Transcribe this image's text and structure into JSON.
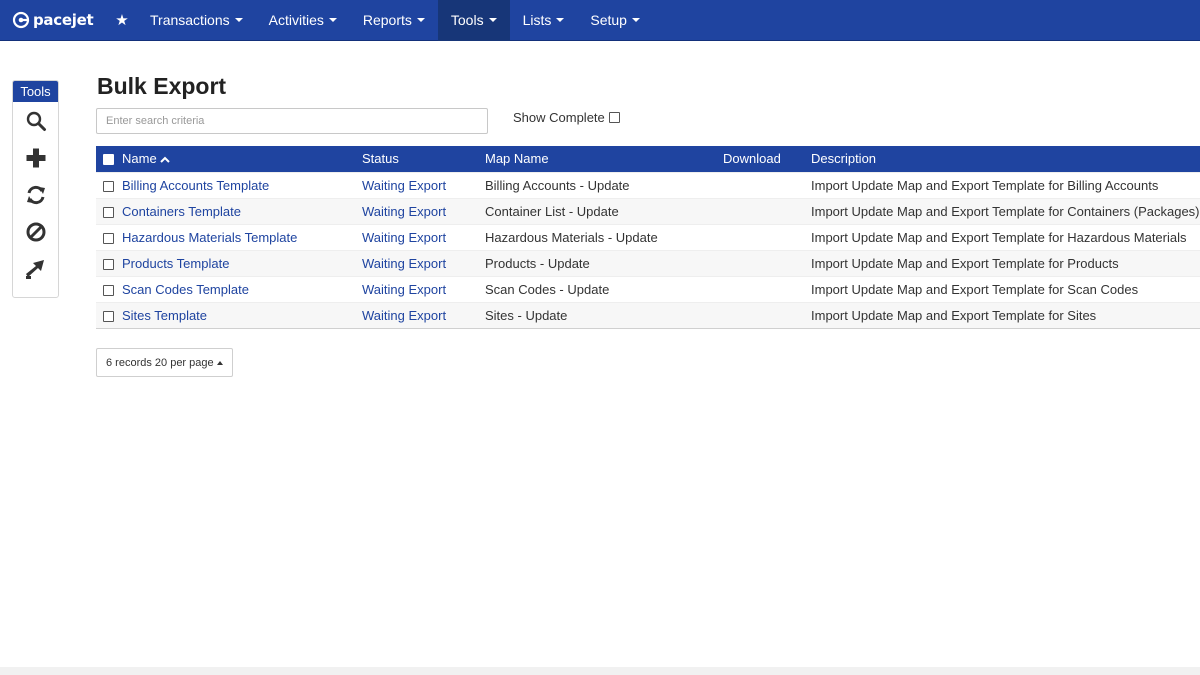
{
  "brand": {
    "name": "pacejet"
  },
  "nav": {
    "items": [
      {
        "label": "Transactions",
        "active": false
      },
      {
        "label": "Activities",
        "active": false
      },
      {
        "label": "Reports",
        "active": false
      },
      {
        "label": "Tools",
        "active": true
      },
      {
        "label": "Lists",
        "active": false
      },
      {
        "label": "Setup",
        "active": false
      }
    ]
  },
  "tools": {
    "title": "Tools",
    "buttons": [
      "search-icon",
      "plus-icon",
      "refresh-icon",
      "cancel-icon",
      "export-arrow-icon"
    ]
  },
  "page": {
    "title": "Bulk Export"
  },
  "search": {
    "placeholder": "Enter search criteria",
    "value": ""
  },
  "filters": {
    "show_complete_label": "Show Complete",
    "show_complete_checked": false
  },
  "grid": {
    "columns": [
      "Name",
      "Status",
      "Map Name",
      "Download",
      "Description"
    ],
    "sort": {
      "column": "Name",
      "direction": "asc"
    },
    "rows": [
      {
        "name": "Billing Accounts Template",
        "status": "Waiting Export",
        "map_name": "Billing Accounts - Update",
        "download": "",
        "description": "Import Update Map and Export Template for Billing Accounts"
      },
      {
        "name": "Containers Template",
        "status": "Waiting Export",
        "map_name": "Container List - Update",
        "download": "",
        "description": "Import Update Map and Export Template for Containers (Packages)"
      },
      {
        "name": "Hazardous Materials Template",
        "status": "Waiting Export",
        "map_name": "Hazardous Materials - Update",
        "download": "",
        "description": "Import Update Map and Export Template for Hazardous Materials"
      },
      {
        "name": "Products Template",
        "status": "Waiting Export",
        "map_name": "Products - Update",
        "download": "",
        "description": "Import Update Map and Export Template for Products"
      },
      {
        "name": "Scan Codes Template",
        "status": "Waiting Export",
        "map_name": "Scan Codes - Update",
        "download": "",
        "description": "Import Update Map and Export Template for Scan Codes"
      },
      {
        "name": "Sites Template",
        "status": "Waiting Export",
        "map_name": "Sites - Update",
        "download": "",
        "description": "Import Update Map and Export Template for Sites"
      }
    ]
  },
  "pager": {
    "label": "6 records 20 per page"
  },
  "colors": {
    "primary": "#1f44a0",
    "nav_active": "#173678",
    "link": "#1f44a0"
  }
}
